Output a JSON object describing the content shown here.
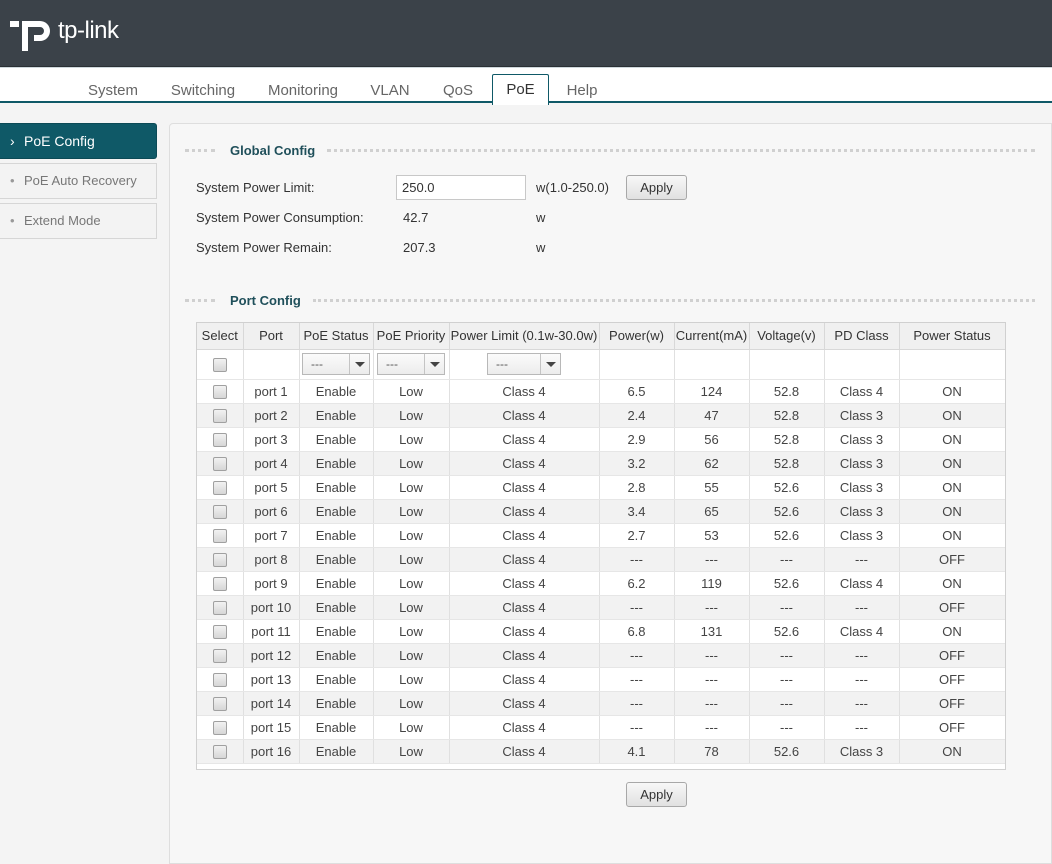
{
  "brand": {
    "logo_text": "tp-link"
  },
  "tabs": [
    {
      "label": "System"
    },
    {
      "label": "Switching"
    },
    {
      "label": "Monitoring"
    },
    {
      "label": "VLAN"
    },
    {
      "label": "QoS"
    },
    {
      "label": "PoE",
      "active": true
    },
    {
      "label": "Help"
    }
  ],
  "sidebar": {
    "items": [
      {
        "label": "PoE Config",
        "bullet": "›",
        "active": true
      },
      {
        "label": "PoE Auto Recovery",
        "bullet": "•"
      },
      {
        "label": "Extend Mode",
        "bullet": "•"
      }
    ]
  },
  "global_config": {
    "title": "Global Config",
    "power_limit_label": "System Power Limit:",
    "power_limit_value": "250.0",
    "power_limit_range": "w(1.0-250.0)",
    "apply_label": "Apply",
    "consumption_label": "System Power Consumption:",
    "consumption_value": "42.7",
    "consumption_unit": "w",
    "remain_label": "System Power Remain:",
    "remain_value": "207.3",
    "remain_unit": "w"
  },
  "port_config": {
    "title": "Port Config",
    "columns": [
      "Select",
      "Port",
      "PoE Status",
      "PoE Priority",
      "Power Limit (0.1w-30.0w)",
      "Power(w)",
      "Current(mA)",
      "Voltage(v)",
      "PD Class",
      "Power Status"
    ],
    "filter_placeholder": "---",
    "rows": [
      [
        "port 1",
        "Enable",
        "Low",
        "Class 4",
        "6.5",
        "124",
        "52.8",
        "Class 4",
        "ON"
      ],
      [
        "port 2",
        "Enable",
        "Low",
        "Class 4",
        "2.4",
        "47",
        "52.8",
        "Class 3",
        "ON"
      ],
      [
        "port 3",
        "Enable",
        "Low",
        "Class 4",
        "2.9",
        "56",
        "52.8",
        "Class 3",
        "ON"
      ],
      [
        "port 4",
        "Enable",
        "Low",
        "Class 4",
        "3.2",
        "62",
        "52.8",
        "Class 3",
        "ON"
      ],
      [
        "port 5",
        "Enable",
        "Low",
        "Class 4",
        "2.8",
        "55",
        "52.6",
        "Class 3",
        "ON"
      ],
      [
        "port 6",
        "Enable",
        "Low",
        "Class 4",
        "3.4",
        "65",
        "52.6",
        "Class 3",
        "ON"
      ],
      [
        "port 7",
        "Enable",
        "Low",
        "Class 4",
        "2.7",
        "53",
        "52.6",
        "Class 3",
        "ON"
      ],
      [
        "port 8",
        "Enable",
        "Low",
        "Class 4",
        "---",
        "---",
        "---",
        "---",
        "OFF"
      ],
      [
        "port 9",
        "Enable",
        "Low",
        "Class 4",
        "6.2",
        "119",
        "52.6",
        "Class 4",
        "ON"
      ],
      [
        "port 10",
        "Enable",
        "Low",
        "Class 4",
        "---",
        "---",
        "---",
        "---",
        "OFF"
      ],
      [
        "port 11",
        "Enable",
        "Low",
        "Class 4",
        "6.8",
        "131",
        "52.6",
        "Class 4",
        "ON"
      ],
      [
        "port 12",
        "Enable",
        "Low",
        "Class 4",
        "---",
        "---",
        "---",
        "---",
        "OFF"
      ],
      [
        "port 13",
        "Enable",
        "Low",
        "Class 4",
        "---",
        "---",
        "---",
        "---",
        "OFF"
      ],
      [
        "port 14",
        "Enable",
        "Low",
        "Class 4",
        "---",
        "---",
        "---",
        "---",
        "OFF"
      ],
      [
        "port 15",
        "Enable",
        "Low",
        "Class 4",
        "---",
        "---",
        "---",
        "---",
        "OFF"
      ],
      [
        "port 16",
        "Enable",
        "Low",
        "Class 4",
        "4.1",
        "78",
        "52.6",
        "Class 3",
        "ON"
      ]
    ],
    "apply_label": "Apply"
  }
}
